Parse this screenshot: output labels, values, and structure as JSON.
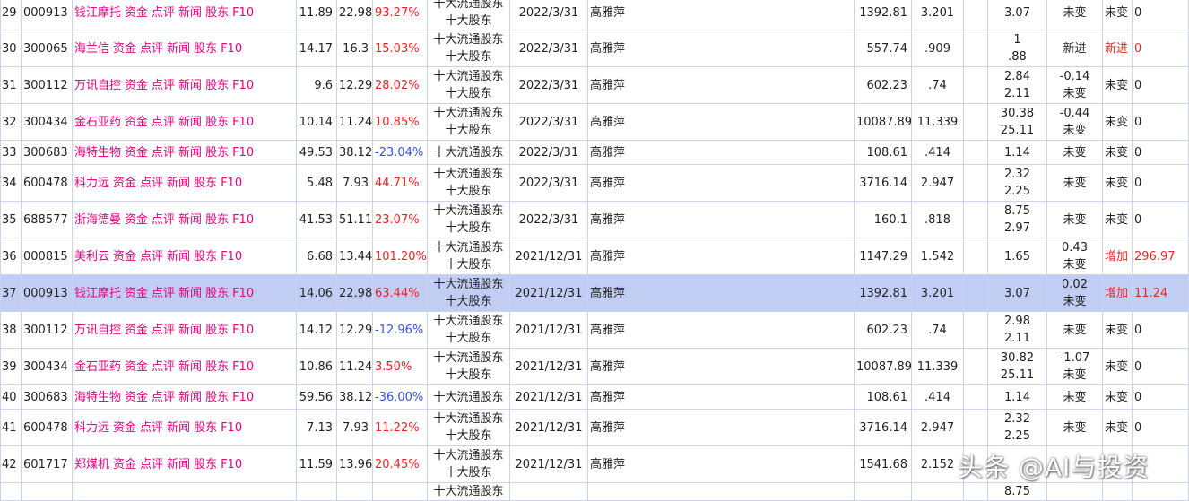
{
  "rows": [
    {
      "idx": "29",
      "code": "000913",
      "name": "钱江摩托",
      "name_red": false,
      "price": "11.89",
      "target": "22.98",
      "pct": "93.27%",
      "pct_color": "red",
      "type1": "十大流通股东",
      "type2": "十大股东",
      "date": "2022/3/31",
      "holder": "高雅萍",
      "v1": "1392.81",
      "v2": "3.201",
      "v3a": "3.07",
      "v3b": "",
      "chg_a": "",
      "chg_b": "未变",
      "state": "未变",
      "state_red": false,
      "amt": "0",
      "amt_red": false,
      "hl": false
    },
    {
      "idx": "30",
      "code": "300065",
      "name": "海兰信",
      "name_red": true,
      "price": "14.17",
      "target": "16.3",
      "pct": "15.03%",
      "pct_color": "red",
      "type1": "十大流通股东",
      "type2": "十大股东",
      "date": "2022/3/31",
      "holder": "高雅萍",
      "v1": "557.74",
      "v2": ".909",
      "v3a": "1",
      "v3b": ".88",
      "chg_a": "",
      "chg_b": "新进",
      "state": "新进",
      "state_red": true,
      "amt": "0",
      "amt_red": true,
      "hl": false
    },
    {
      "idx": "31",
      "code": "300112",
      "name": "万讯自控",
      "name_red": false,
      "price": "9.6",
      "target": "12.29",
      "pct": "28.02%",
      "pct_color": "red",
      "type1": "十大流通股东",
      "type2": "十大股东",
      "date": "2022/3/31",
      "holder": "高雅萍",
      "v1": "602.23",
      "v2": ".74",
      "v3a": "2.84",
      "v3b": "2.11",
      "chg_a": "-0.14",
      "chg_b": "未变",
      "state": "未变",
      "state_red": false,
      "amt": "0",
      "amt_red": false,
      "hl": false
    },
    {
      "idx": "32",
      "code": "300434",
      "name": "金石亚药",
      "name_red": false,
      "price": "10.14",
      "target": "11.24",
      "pct": "10.85%",
      "pct_color": "red",
      "type1": "十大流通股东",
      "type2": "十大股东",
      "date": "2022/3/31",
      "holder": "高雅萍",
      "v1": "10087.89",
      "v2": "11.339",
      "v3a": "30.38",
      "v3b": "25.11",
      "chg_a": "-0.44",
      "chg_b": "未变",
      "state": "未变",
      "state_red": false,
      "amt": "0",
      "amt_red": false,
      "hl": false
    },
    {
      "idx": "33",
      "code": "300683",
      "name": "海特生物",
      "name_red": false,
      "price": "49.53",
      "target": "38.12",
      "pct": "-23.04%",
      "pct_color": "blue",
      "type1": "十大流通股东",
      "type2": "",
      "date": "2022/3/31",
      "holder": "高雅萍",
      "v1": "108.61",
      "v2": ".414",
      "v3a": "1.14",
      "v3b": "",
      "chg_a": "",
      "chg_b": "未变",
      "state": "未变",
      "state_red": false,
      "amt": "0",
      "amt_red": false,
      "hl": false
    },
    {
      "idx": "34",
      "code": "600478",
      "name": "科力远",
      "name_red": false,
      "price": "5.48",
      "target": "7.93",
      "pct": "44.71%",
      "pct_color": "red",
      "type1": "十大流通股东",
      "type2": "十大股东",
      "date": "2022/3/31",
      "holder": "高雅萍",
      "v1": "3716.14",
      "v2": "2.947",
      "v3a": "2.32",
      "v3b": "2.25",
      "chg_a": "",
      "chg_b": "未变",
      "state": "未变",
      "state_red": false,
      "amt": "0",
      "amt_red": false,
      "hl": false
    },
    {
      "idx": "35",
      "code": "688577",
      "name": "浙海德曼",
      "name_red": false,
      "price": "41.53",
      "target": "51.11",
      "pct": "23.07%",
      "pct_color": "red",
      "type1": "十大流通股东",
      "type2": "十大股东",
      "date": "2022/3/31",
      "holder": "高雅萍",
      "v1": "160.1",
      "v2": ".818",
      "v3a": "8.75",
      "v3b": "2.97",
      "chg_a": "",
      "chg_b": "未变",
      "state": "未变",
      "state_red": false,
      "amt": "0",
      "amt_red": false,
      "hl": false
    },
    {
      "idx": "36",
      "code": "000815",
      "name": "美利云",
      "name_red": true,
      "price": "6.68",
      "target": "13.44",
      "pct": "101.20%",
      "pct_color": "red",
      "type1": "十大流通股东",
      "type2": "十大股东",
      "date": "2021/12/31",
      "holder": "高雅萍",
      "v1": "1147.29",
      "v2": "1.542",
      "v3a": "1.65",
      "v3b": "",
      "chg_a": "0.43",
      "chg_b": "未变",
      "state": "增加",
      "state_red": true,
      "amt": "296.97",
      "amt_red": true,
      "hl": false
    },
    {
      "idx": "37",
      "code": "000913",
      "name": "钱江摩托",
      "name_red": true,
      "price": "14.06",
      "target": "22.98",
      "pct": "63.44%",
      "pct_color": "red",
      "type1": "十大流通股东",
      "type2": "十大股东",
      "date": "2021/12/31",
      "holder": "高雅萍",
      "v1": "1392.81",
      "v2": "3.201",
      "v3a": "3.07",
      "v3b": "",
      "chg_a": "0.02",
      "chg_b": "未变",
      "state": "增加",
      "state_red": true,
      "amt": "11.24",
      "amt_red": true,
      "hl": true
    },
    {
      "idx": "38",
      "code": "300112",
      "name": "万讯自控",
      "name_red": false,
      "price": "14.12",
      "target": "12.29",
      "pct": "-12.96%",
      "pct_color": "blue",
      "type1": "十大流通股东",
      "type2": "十大股东",
      "date": "2021/12/31",
      "holder": "高雅萍",
      "v1": "602.23",
      "v2": ".74",
      "v3a": "2.98",
      "v3b": "2.11",
      "chg_a": "",
      "chg_b": "未变",
      "state": "未变",
      "state_red": false,
      "amt": "0",
      "amt_red": false,
      "hl": false
    },
    {
      "idx": "39",
      "code": "300434",
      "name": "金石亚药",
      "name_red": false,
      "price": "10.86",
      "target": "11.24",
      "pct": "3.50%",
      "pct_color": "red",
      "type1": "十大流通股东",
      "type2": "十大股东",
      "date": "2021/12/31",
      "holder": "高雅萍",
      "v1": "10087.89",
      "v2": "11.339",
      "v3a": "30.82",
      "v3b": "25.11",
      "chg_a": "-1.07",
      "chg_b": "未变",
      "state": "未变",
      "state_red": false,
      "amt": "0",
      "amt_red": false,
      "hl": false
    },
    {
      "idx": "40",
      "code": "300683",
      "name": "海特生物",
      "name_red": false,
      "price": "59.56",
      "target": "38.12",
      "pct": "-36.00%",
      "pct_color": "blue",
      "type1": "十大流通股东",
      "type2": "",
      "date": "2021/12/31",
      "holder": "高雅萍",
      "v1": "108.61",
      "v2": ".414",
      "v3a": "1.14",
      "v3b": "",
      "chg_a": "",
      "chg_b": "未变",
      "state": "未变",
      "state_red": false,
      "amt": "0",
      "amt_red": false,
      "hl": false
    },
    {
      "idx": "41",
      "code": "600478",
      "name": "科力远",
      "name_red": false,
      "price": "7.13",
      "target": "7.93",
      "pct": "11.22%",
      "pct_color": "red",
      "type1": "十大流通股东",
      "type2": "十大股东",
      "date": "2021/12/31",
      "holder": "高雅萍",
      "v1": "3716.14",
      "v2": "2.947",
      "v3a": "2.32",
      "v3b": "2.25",
      "chg_a": "",
      "chg_b": "未变",
      "state": "未变",
      "state_red": false,
      "amt": "0",
      "amt_red": false,
      "hl": false
    },
    {
      "idx": "42",
      "code": "601717",
      "name": "郑煤机",
      "name_red": false,
      "price": "11.59",
      "target": "13.96",
      "pct": "20.45%",
      "pct_color": "red",
      "type1": "十大流通股东",
      "type2": "十大股东",
      "date": "2021/12/31",
      "holder": "高雅萍",
      "v1": "1541.68",
      "v2": "2.152",
      "v3a": "",
      "v3b": "",
      "chg_a": "",
      "chg_b": "",
      "state": "",
      "state_red": false,
      "amt": "",
      "amt_red": false,
      "hl": false
    },
    {
      "idx": "",
      "code": "",
      "name": "",
      "name_red": false,
      "price": "",
      "target": "",
      "pct": "",
      "pct_color": "red",
      "type1": "十大流通股东",
      "type2": "",
      "date": "",
      "holder": "",
      "v1": "",
      "v2": "",
      "v3a": "8.75",
      "v3b": "",
      "chg_a": "",
      "chg_b": "",
      "state": "",
      "state_red": false,
      "amt": "",
      "amt_red": false,
      "hl": false
    }
  ],
  "link_labels": [
    "资金",
    "点评",
    "新闻",
    "股东",
    "F10"
  ],
  "watermark": "头条 @AI与投资",
  "colors": {
    "red": "#ee2222",
    "blue": "#3355dd",
    "link": "#e6007e",
    "highlight": "#c2cdf4"
  }
}
